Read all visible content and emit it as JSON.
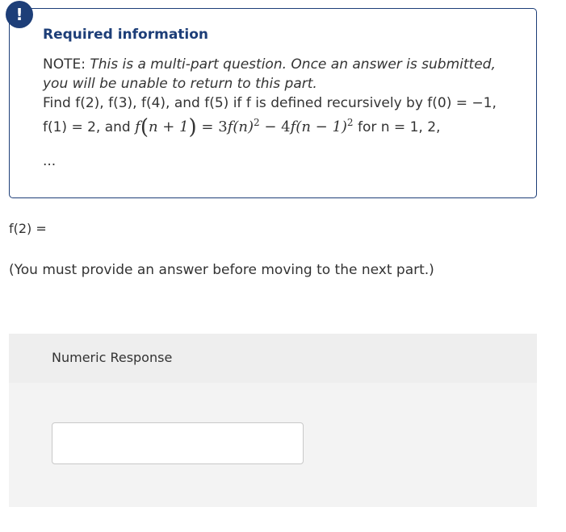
{
  "alert": {
    "icon_glyph": "!",
    "icon_name": "exclamation-icon",
    "color": "#1d3e78"
  },
  "info": {
    "title": "Required information",
    "note_prefix": "NOTE: ",
    "note_text": "This is a multi-part question. Once an answer is submitted, you will be unable to return to this part.",
    "find_text": "Find f(2), f(3), f(4), and f(5) if f is defined recursively by f(0) = −1,",
    "f1_text": "f(1) = 2, and ",
    "formula": {
      "lhs_f": "f",
      "lhs_open": "(",
      "lhs_inner": "n + 1",
      "lhs_close": ")",
      "eq": " = 3",
      "term1_f": "f",
      "term1_arg": "(n)",
      "term1_exp": "2",
      "minus": " − 4",
      "term2_f": "f",
      "term2_arg": "(n − 1)",
      "term2_exp": "2"
    },
    "for_text": " for ",
    "n_range": "n = 1, 2,",
    "ellipsis": "..."
  },
  "question": {
    "label": "f(2) ="
  },
  "instruction": "(You must provide an answer before moving to the next part.)",
  "response": {
    "header_label": "Numeric Response",
    "input_value": ""
  }
}
